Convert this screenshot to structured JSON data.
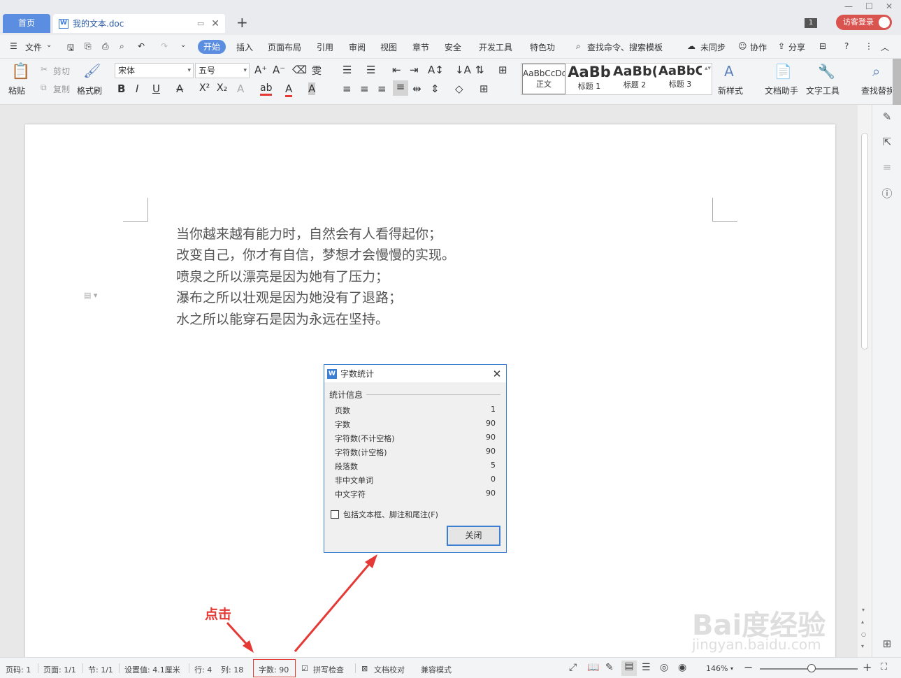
{
  "tabs": {
    "home": "首页",
    "doc_name": "我的文本.doc",
    "add": "+",
    "badge": "1",
    "login": "访客登录"
  },
  "menu": {
    "file": "文件",
    "start": "开始",
    "items": [
      "插入",
      "页面布局",
      "引用",
      "审阅",
      "视图",
      "章节",
      "安全",
      "开发工具",
      "特色功"
    ],
    "search": "查找命令、搜索模板",
    "unsync": "未同步",
    "collab": "协作",
    "share": "分享"
  },
  "ribbon": {
    "paste": "粘贴",
    "cut": "剪切",
    "copy": "复制",
    "format_painter": "格式刷",
    "font_name": "宋体",
    "font_size": "五号",
    "styles": [
      {
        "sample": "AaBbCcDd",
        "label": "正文"
      },
      {
        "sample": "AaBb",
        "label": "标题 1"
      },
      {
        "sample": "AaBb(",
        "label": "标题 2"
      },
      {
        "sample": "AaBbC",
        "label": "标题 3"
      }
    ],
    "new_style": "新样式",
    "doc_assistant": "文档助手",
    "text_tools": "文字工具",
    "find_replace": "查找替换"
  },
  "document": {
    "lines": [
      "当你越来越有能力时，自然会有人看得起你；",
      "改变自己，你才有自信，梦想才会慢慢的实现。",
      "喷泉之所以漂亮是因为她有了压力；",
      "瀑布之所以壮观是因为她没有了退路；",
      "水之所以能穿石是因为永远在坚持。"
    ]
  },
  "dialog": {
    "title": "字数统计",
    "group": "统计信息",
    "stats": [
      {
        "label": "页数",
        "value": "1"
      },
      {
        "label": "字数",
        "value": "90"
      },
      {
        "label": "字符数(不计空格)",
        "value": "90"
      },
      {
        "label": "字符数(计空格)",
        "value": "90"
      },
      {
        "label": "段落数",
        "value": "5"
      },
      {
        "label": "非中文单词",
        "value": "0"
      },
      {
        "label": "中文字符",
        "value": "90"
      }
    ],
    "checkbox": "包括文本框、脚注和尾注(F)",
    "close_button": "关闭"
  },
  "annotation": {
    "label": "点击",
    "color": "#e53935"
  },
  "watermark": {
    "text": "Bai度经验",
    "url": "jingyan.baidu.com"
  },
  "status": {
    "page_no": "页码: 1",
    "page": "页面: 1/1",
    "section": "节: 1/1",
    "setting": "设置值: 4.1厘米",
    "row": "行: 4",
    "col": "列: 18",
    "word_count": "字数: 90",
    "spell_check": "拼写检查",
    "doc_proof": "文档校对",
    "compat_mode": "兼容模式",
    "zoom": "146%"
  },
  "colors": {
    "accent": "#5b8de0",
    "dialog_border": "#3c7fd2",
    "annotation": "#e53935"
  }
}
